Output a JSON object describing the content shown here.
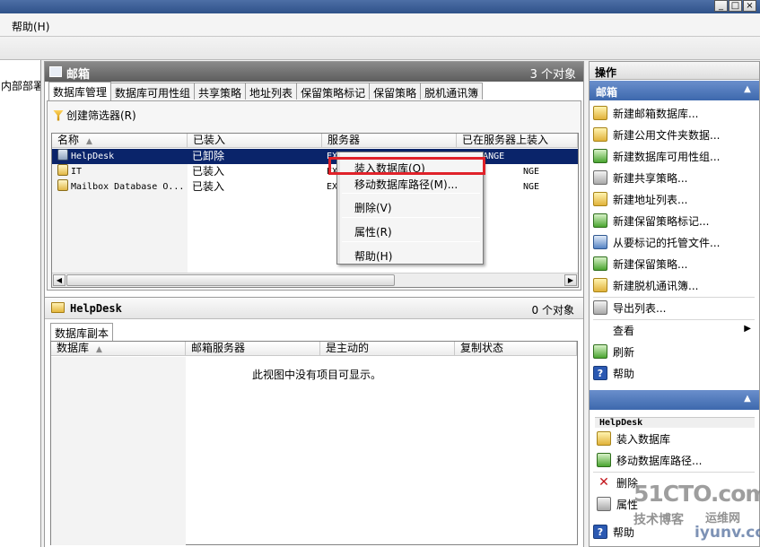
{
  "titlebar": {
    "min": "_",
    "max": "□",
    "close": "×"
  },
  "menu": {
    "help": "帮助(H)"
  },
  "tree": {
    "node": "内部部署"
  },
  "center": {
    "title": "邮箱",
    "count": "3 个对象",
    "tabs": [
      "数据库管理",
      "数据库可用性组",
      "共享策略",
      "地址列表",
      "保留策略标记",
      "保留策略",
      "脱机通讯簿"
    ],
    "filter_label": "创建筛选器(R)",
    "columns": [
      "名称",
      "已装入",
      "服务器",
      "已在服务器上装入"
    ],
    "rows": [
      {
        "name": "HelpDesk",
        "mounted": "已卸除",
        "server": "EXCHANGE",
        "mounted_on": "EXCHANGE"
      },
      {
        "name": "IT",
        "mounted": "已装入",
        "server": "EX",
        "mounted_on": "NGE"
      },
      {
        "name": "Mailbox Database O...",
        "mounted": "已装入",
        "server": "EX",
        "mounted_on": "NGE"
      }
    ]
  },
  "context_menu": {
    "items": [
      "装入数据库(O)",
      "移动数据库路径(M)...",
      "删除(V)",
      "属性(R)",
      "帮助(H)"
    ]
  },
  "sub": {
    "title": "HelpDesk",
    "count": "0 个对象",
    "tab": "数据库副本",
    "columns": [
      "数据库",
      "邮箱服务器",
      "是主动的",
      "复制状态"
    ],
    "empty_text": "此视图中没有项目可显示。"
  },
  "actions": {
    "header": "操作",
    "section1": "邮箱",
    "items1": [
      "新建邮箱数据库...",
      "新建公用文件夹数据...",
      "新建数据库可用性组...",
      "新建共享策略...",
      "新建地址列表...",
      "新建保留策略标记...",
      "从要标记的托管文件...",
      "新建保留策略...",
      "新建脱机通讯簿...",
      "导出列表...",
      "查看",
      "刷新",
      "帮助"
    ],
    "helpdesk_header": "HelpDesk",
    "items2": [
      "装入数据库",
      "移动数据库路径...",
      "删除",
      "属性",
      "帮助"
    ]
  },
  "watermark": {
    "site": "51CTO.com",
    "slogan": "技术博客",
    "tag": "运维网",
    "domain": "iyunv.com"
  }
}
